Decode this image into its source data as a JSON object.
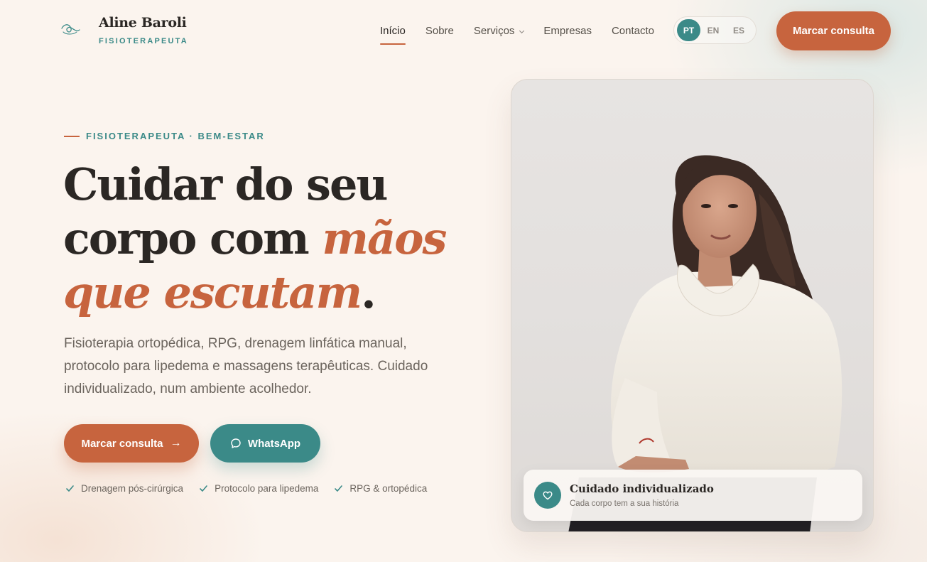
{
  "brand": {
    "name": "Aline Baroli",
    "tagline": "FISIOTERAPEUTA"
  },
  "nav": {
    "items": [
      {
        "label": "Início",
        "active": true
      },
      {
        "label": "Sobre"
      },
      {
        "label": "Serviços",
        "dropdown": true
      },
      {
        "label": "Empresas"
      },
      {
        "label": "Contacto"
      }
    ]
  },
  "lang": {
    "options": [
      "PT",
      "EN",
      "ES"
    ],
    "selected": "PT"
  },
  "header_cta": "Marcar consulta",
  "hero": {
    "eyebrow": "FISIOTERAPEUTA · BEM-ESTAR",
    "headline_1": "Cuidar do seu",
    "headline_2": "corpo com ",
    "headline_accent_1": "mãos",
    "headline_accent_2": "que escutam",
    "headline_end": ".",
    "lead": "Fisioterapia ortopédica, RPG, drenagem linfática manual, protocolo para lipedema e massagens terapêuticas. Cuidado individualizado, num ambiente acolhedor.",
    "cta_primary": "Marcar consulta",
    "cta_whatsapp": "WhatsApp",
    "checks": [
      "Drenagem pós-cirúrgica",
      "Protocolo para lipedema",
      "RPG & ortopédica"
    ]
  },
  "card": {
    "title": "Cuidado individualizado",
    "subtitle": "Cada corpo tem a sua história"
  },
  "colors": {
    "accent": "#c7643e",
    "teal": "#3b8a88",
    "background": "#fbf4ee",
    "text": "#2b2724"
  },
  "icons": {
    "logo": "spiral-leaf-icon",
    "cta_arrow": "arrow-right-icon",
    "whatsapp": "chat-bubble-icon",
    "check": "check-icon",
    "card": "heart-icon"
  }
}
